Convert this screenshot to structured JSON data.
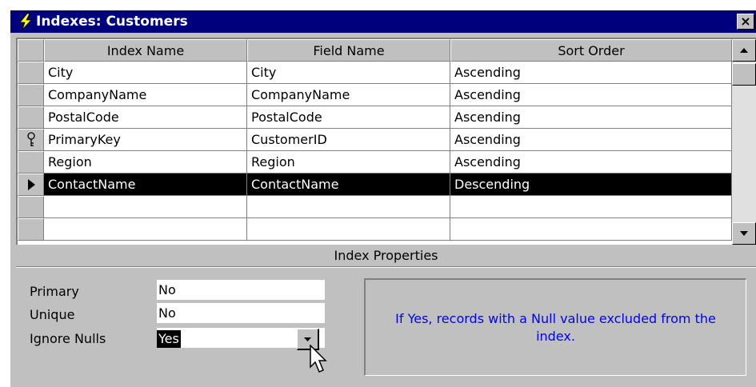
{
  "window": {
    "title": "Indexes: Customers",
    "close_label": "×"
  },
  "grid": {
    "columns": [
      "Index Name",
      "Field Name",
      "Sort Order"
    ],
    "rows": [
      {
        "index_name": "City",
        "field_name": "City",
        "sort_order": "Ascending",
        "key": false,
        "selected": false
      },
      {
        "index_name": "CompanyName",
        "field_name": "CompanyName",
        "sort_order": "Ascending",
        "key": false,
        "selected": false
      },
      {
        "index_name": "PostalCode",
        "field_name": "PostalCode",
        "sort_order": "Ascending",
        "key": false,
        "selected": false
      },
      {
        "index_name": "PrimaryKey",
        "field_name": "CustomerID",
        "sort_order": "Ascending",
        "key": true,
        "selected": false
      },
      {
        "index_name": "Region",
        "field_name": "Region",
        "sort_order": "Ascending",
        "key": false,
        "selected": false
      },
      {
        "index_name": "ContactName",
        "field_name": "ContactName",
        "sort_order": "Descending",
        "key": false,
        "selected": true
      }
    ]
  },
  "properties": {
    "header": "Index Properties",
    "primary_label": "Primary",
    "primary_value": "No",
    "unique_label": "Unique",
    "unique_value": "No",
    "ignore_nulls_label": "Ignore Nulls",
    "ignore_nulls_value": "Yes",
    "help_text": "If Yes, records with a Null value excluded from the index."
  },
  "colors": {
    "titlebar": "#00007f",
    "face": "#c0c0c0",
    "help_text": "#0000ff"
  },
  "icons": [
    "lightning-icon",
    "close-icon",
    "key-icon",
    "row-pointer-icon",
    "scroll-up-icon",
    "scroll-down-icon",
    "dropdown-arrow-icon",
    "mouse-cursor-icon"
  ]
}
